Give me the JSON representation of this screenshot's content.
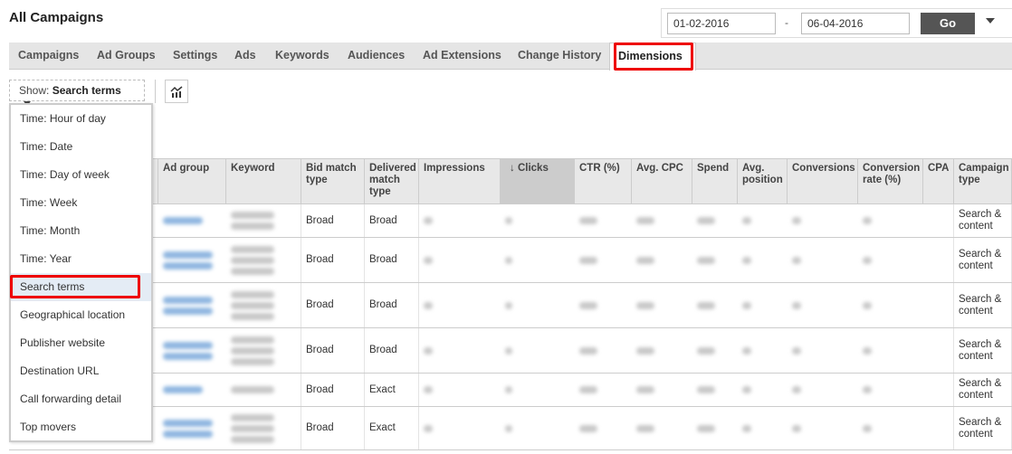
{
  "header": {
    "title": "All Campaigns"
  },
  "date_range": {
    "start": "01-02-2016",
    "separator": "-",
    "end": "06-04-2016",
    "go_label": "Go"
  },
  "tabs": [
    {
      "label": "Campaigns"
    },
    {
      "label": "Ad Groups"
    },
    {
      "label": "Settings"
    },
    {
      "label": "Ads"
    },
    {
      "label": "Keywords"
    },
    {
      "label": "Audiences"
    },
    {
      "label": "Ad Extensions"
    },
    {
      "label": "Change History"
    },
    {
      "label": "Dimensions",
      "active": true
    }
  ],
  "toolbar": {
    "show_prefix": "Show:",
    "show_value": "Search terms",
    "chart_icon": "chart-icon"
  },
  "dropdown": {
    "selected": "Search terms",
    "items": [
      "Time: Hour of day",
      "Time: Date",
      "Time: Day of week",
      "Time: Week",
      "Time: Month",
      "Time: Year",
      "Search terms",
      "Geographical location",
      "Publisher website",
      "Destination URL",
      "Call forwarding detail",
      "Top movers"
    ]
  },
  "table": {
    "columns": [
      "Ad group",
      "Keyword",
      "Bid match type",
      "Delivered match type",
      "Impressions",
      "Clicks",
      "CTR (%)",
      "Avg. CPC",
      "Spend",
      "Avg. position",
      "Conversions",
      "Conversion rate (%)",
      "CPA",
      "Campaign type"
    ],
    "sorted_column": "Clicks",
    "sort_direction": "descending",
    "rows": [
      {
        "bid_match": "Broad",
        "delivered_match": "Broad",
        "campaign_type": "Search & content"
      },
      {
        "bid_match": "Broad",
        "delivered_match": "Broad",
        "campaign_type": "Search & content"
      },
      {
        "bid_match": "Broad",
        "delivered_match": "Broad",
        "campaign_type": "Search & content"
      },
      {
        "bid_match": "Broad",
        "delivered_match": "Broad",
        "campaign_type": "Search & content"
      },
      {
        "bid_match": "Broad",
        "delivered_match": "Exact",
        "campaign_type": "Search & content"
      },
      {
        "bid_match": "Broad",
        "delivered_match": "Exact",
        "campaign_type": "Search & content"
      }
    ]
  },
  "colors": {
    "highlight": "#e00000",
    "go_button": "#555555",
    "tab_bar": "#e5e5e5",
    "link": "#1a62b5"
  }
}
